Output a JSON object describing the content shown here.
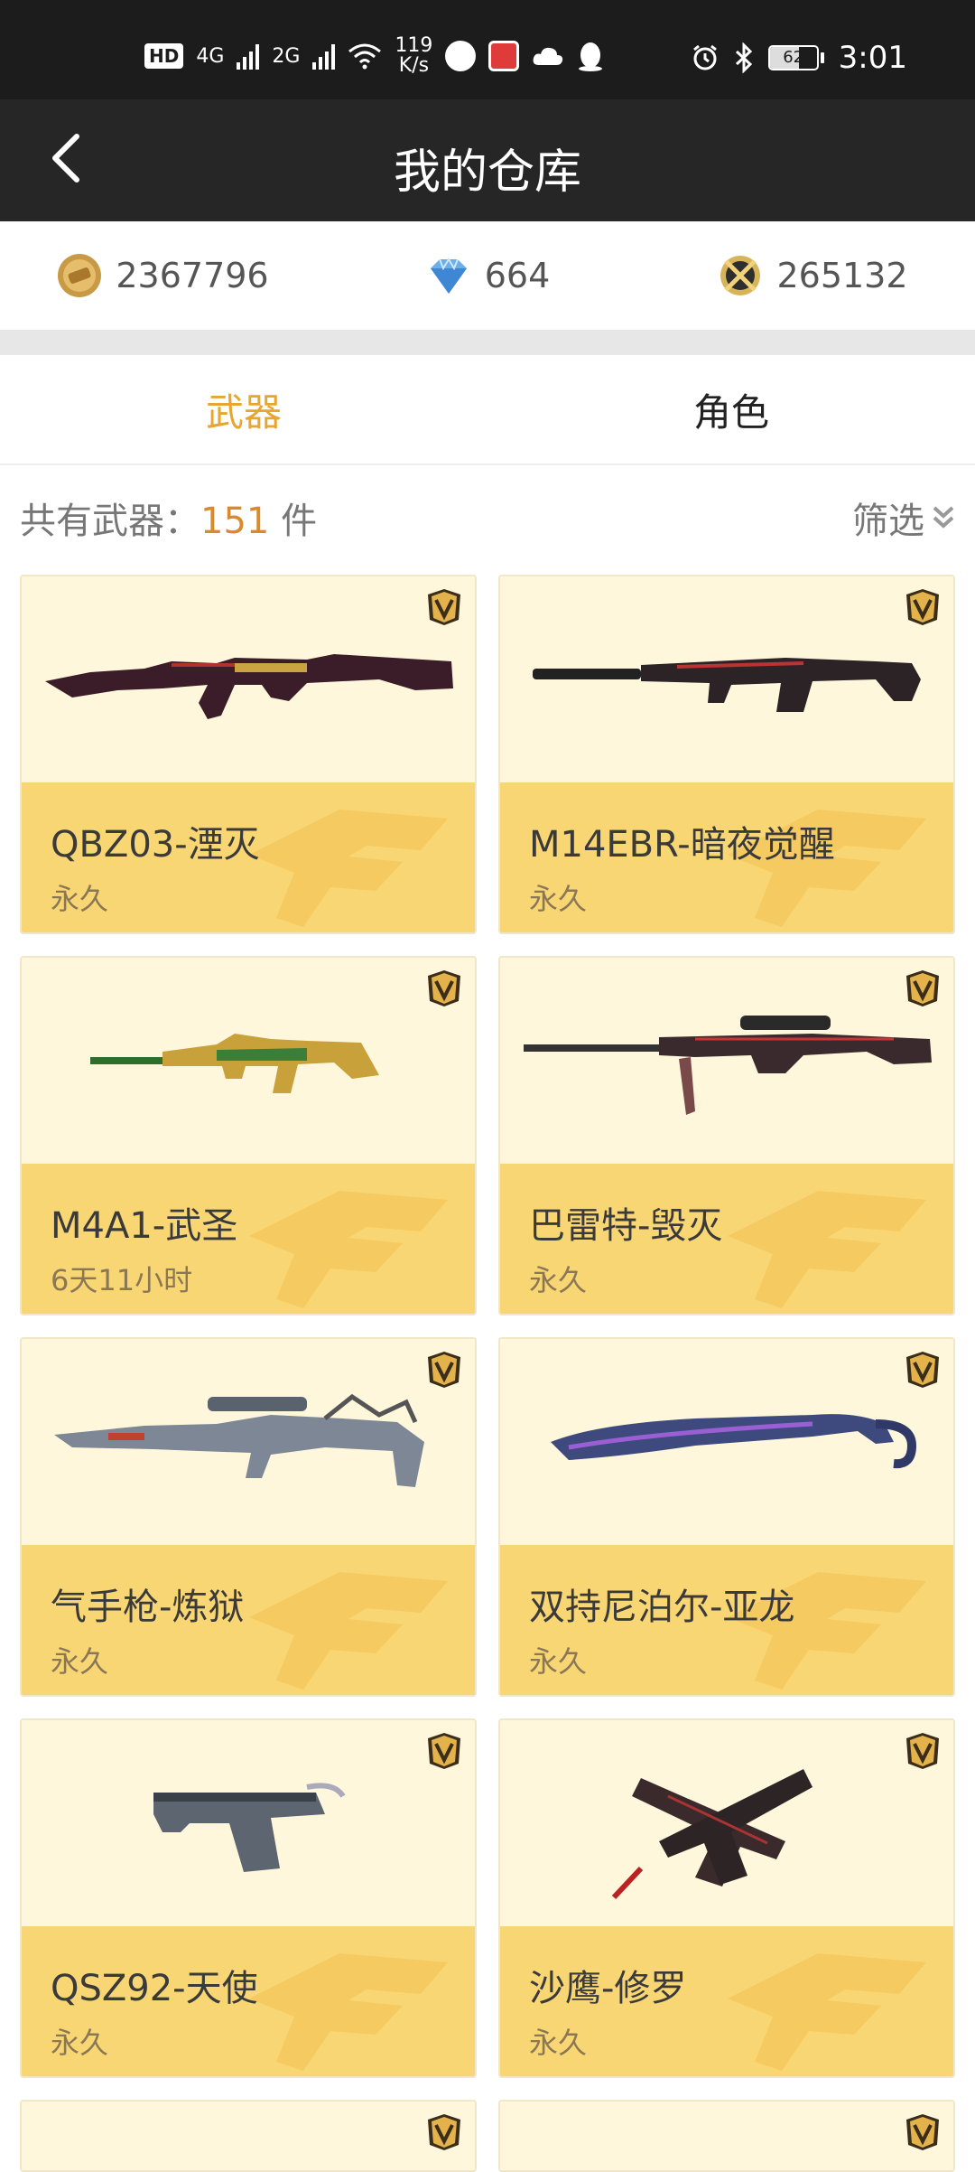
{
  "status_bar": {
    "left_badge": "HD",
    "sim1_tech": "4G",
    "sim2_tech": "2G",
    "net_speed_value": "119",
    "net_speed_unit": "K/s",
    "battery_level": "62",
    "time": "3:01"
  },
  "header": {
    "title": "我的仓库",
    "back_icon": "chevron-left-icon"
  },
  "currency": {
    "coin": "2367796",
    "diamond": "664",
    "points": "265132"
  },
  "tabs": [
    {
      "label": "武器",
      "active": true
    },
    {
      "label": "角色",
      "active": false
    }
  ],
  "summary": {
    "prefix": "共有武器：",
    "count": "151",
    "suffix": " 件",
    "filter_label": "筛选"
  },
  "weapons": [
    {
      "name": "QBZ03-湮灭",
      "duration": "永久",
      "art": "rifle-dark"
    },
    {
      "name": "M14EBR-暗夜觉醒",
      "duration": "永久",
      "art": "rifle-silencer"
    },
    {
      "name": "M4A1-武圣",
      "duration": "6天11小时",
      "art": "rifle-gold"
    },
    {
      "name": "巴雷特-毁灭",
      "duration": "永久",
      "art": "sniper-dark"
    },
    {
      "name": "气手枪-炼狱",
      "duration": "永久",
      "art": "rifle-silver"
    },
    {
      "name": "双持尼泊尔-亚龙",
      "duration": "永久",
      "art": "blade-blue"
    },
    {
      "name": "QSZ92-天使",
      "duration": "永久",
      "art": "pistol-silver"
    },
    {
      "name": "沙鹰-修罗",
      "duration": "永久",
      "art": "pistol-dual"
    }
  ],
  "colors": {
    "accent": "#e8a531",
    "card_top": "#fff7dc",
    "card_bottom": "#f9d674",
    "titlebar": "#262626"
  }
}
